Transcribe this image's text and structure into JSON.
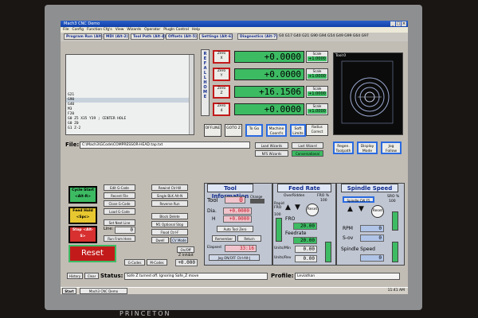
{
  "window": {
    "title": "Mach3 CNC Demo"
  },
  "menu": [
    "File",
    "Config",
    "Function Cfg's",
    "View",
    "Wizards",
    "Operator",
    "PlugIn Control",
    "Help"
  ],
  "tabs": [
    "Program Run (Alt-1)",
    "MDI (Alt-2)",
    "Tool Path (Alt-4)",
    "Offsets (Alt-5)",
    "Settings (Alt-6)",
    "Diagnostics (Alt-7)"
  ],
  "modal_gcodes": "G0 G17 G40 G21 G90 G94 G54 G49 G99 G64 G97",
  "code_lines": [
    "G21",
    "G90",
    "G40",
    "M3",
    "F20",
    "G0 Z5 X35 Y39 ; CENTER HOLE",
    "G0 Z0",
    "G1 Z-2"
  ],
  "ref_all_home": "REF ALL HOME",
  "axes": [
    {
      "zero_label": "Zero",
      "axis": "X",
      "value": "+0.0000",
      "scale_label": "Scale",
      "scale": "+1.0000"
    },
    {
      "zero_label": "Zero",
      "axis": "Y",
      "value": "+0.0000",
      "scale_label": "Scale",
      "scale": "+1.0000"
    },
    {
      "zero_label": "Zero",
      "axis": "Z",
      "value": "+16.1506",
      "scale_label": "Scale",
      "scale": "+1.0000"
    },
    {
      "zero_label": "Zero",
      "axis": "4",
      "value": "+0.0000",
      "scale_label": "Scale",
      "scale": "+1.0000"
    }
  ],
  "radius_correct": "Radius Correct",
  "offline": "OFFLINE",
  "goto_zero": "GOTO Z",
  "to_go": "To Go",
  "machine_coords": "Machine Coord's",
  "soft_limits": "Soft Limits",
  "toolpath_label": "Tool:0",
  "file": {
    "label": "File:",
    "path": "C:\\Mach3\\GCode\\COMPRESSOR-HEAD.tap.txt"
  },
  "wizards": {
    "load": "Load Wizards",
    "last": "Last Wizard",
    "nfs": "NFS Wizards",
    "conversational": "Conversational"
  },
  "regen": "Regen. Toolpath",
  "display_mode": "Display Mode",
  "jog_follow": "Jog Follow",
  "program_buttons": {
    "cycle_start": "Cycle Start <Alt-R>",
    "feed_hold": "Feed Hold <Spc>",
    "stop": "Stop <Alt-S>",
    "edit_gcode": "Edit G-Code",
    "recent_file": "Recent File",
    "close_gcode": "Close G-Code",
    "load_gcode": "Load G-Code",
    "set_next_line": "Set Next Line",
    "line_label": "Line:",
    "line_value": "0",
    "run_from_here": "Run From Here",
    "rewind": "Rewind Ctrl-W",
    "single_blk": "Single BLK Alt-N",
    "reverse_run": "Reverse Run",
    "block_delete": "Block Delete",
    "m1_optional": "M1 Optional Stop",
    "flood": "Flood Ctrl-F",
    "dwell": "Dwell",
    "cv_mode": "CV Mode"
  },
  "reset": "Reset",
  "g_codes": "G-Codes",
  "m_codes": "M-Codes",
  "on_off": "On/Off",
  "z_inhibit_label": "Z Inhibit",
  "z_inhibit": "+0.000",
  "tool_info": {
    "title": "Tool Information",
    "tool_label": "Tool",
    "tool": "0",
    "change": "Change",
    "dia_label": "Dia.",
    "dia": "+0.0000",
    "h_label": "H",
    "h": "+0.0000",
    "auto_tool_zero": "Auto Tool Zero",
    "remember": "Remember",
    "return": "Return",
    "elapsed_label": "Elapsed",
    "elapsed": "33:16",
    "jog_toggle": "Jog ON/OFF Ctrl-Alt-J"
  },
  "feed_rate": {
    "title": "Feed Rate",
    "overridden": "OverRidden",
    "fro_pct": "FRO %",
    "fro_pct_val": "100",
    "rapid_fro": "Rapid FRO",
    "rapid_val": "100",
    "fro_label": "FRO",
    "fro": "20.00",
    "feedrate_label": "Feedrate",
    "feedrate": "20.00",
    "units_min": "Units/Min",
    "units_min_val": "0.00",
    "units_rev": "Units/Rev",
    "units_rev_val": "0.00",
    "reset": "Reset"
  },
  "spindle": {
    "title": "Spindle Speed",
    "cw": "Spindle CW F5",
    "sro_pct": "SRO %",
    "sro_val": "100",
    "rpm_label": "RPM",
    "rpm": "0",
    "sov_label": "S-ov",
    "sov": "0",
    "speed_label": "Spindle Speed",
    "speed": "0",
    "reset": "Reset"
  },
  "status": {
    "history": "History",
    "clear": "Clear",
    "label": "Status:",
    "text": "Safe Z turned off. Ignoring Safe_Z move",
    "profile_label": "Profile:",
    "profile": "Leviathan"
  },
  "taskbar": {
    "start": "Start",
    "task": "Mach3 CNC Demo",
    "clock": "11:41 AM"
  },
  "monitor_brand": "PRINCETON",
  "colors": {
    "dro_green": "#3dbb63",
    "zero_red": "#c21a1a",
    "tab_blue": "#102a8c"
  }
}
